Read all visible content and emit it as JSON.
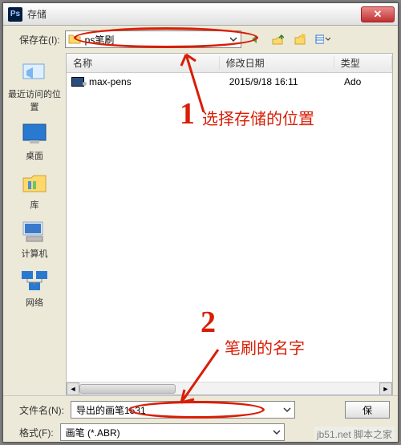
{
  "window": {
    "title": "存储"
  },
  "path": {
    "label": "保存在(I):",
    "folder_name": "ps笔刷"
  },
  "toolbar": {
    "back_icon": "back-icon",
    "up_icon": "up-icon",
    "newfolder_icon": "new-folder-icon",
    "view_icon": "view-icon"
  },
  "sidebar": {
    "items": [
      {
        "label": "最近访问的位置"
      },
      {
        "label": "桌面"
      },
      {
        "label": "库"
      },
      {
        "label": "计算机"
      },
      {
        "label": "网络"
      }
    ]
  },
  "columns": {
    "name": "名称",
    "date": "修改日期",
    "type": "类型"
  },
  "rows": [
    {
      "name": "max-pens",
      "date": "2015/9/18 16:11",
      "type": "Ado"
    }
  ],
  "bottom": {
    "filename_label": "文件名(N):",
    "filename_value": "导出的画笔1531",
    "format_label": "格式(F):",
    "format_value": "画笔 (*.ABR)",
    "save_button": "保"
  },
  "annotations": {
    "num1": "1",
    "label1": "选择存储的位置",
    "num2": "2",
    "label2": "笔刷的名字"
  },
  "watermark": "jb51.net  脚本之家"
}
